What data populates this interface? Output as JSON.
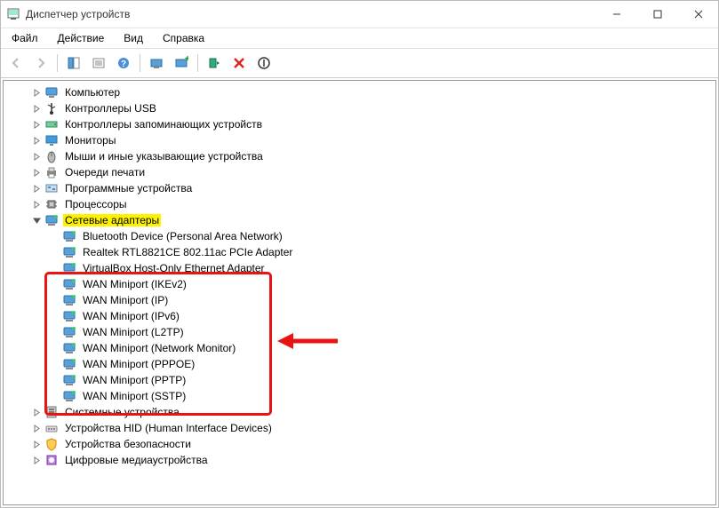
{
  "window": {
    "title": "Диспетчер устройств"
  },
  "menus": {
    "file": "Файл",
    "action": "Действие",
    "view": "Вид",
    "help": "Справка"
  },
  "tree": {
    "top_items": [
      "Компьютер",
      "Контроллеры USB",
      "Контроллеры запоминающих устройств",
      "Мониторы",
      "Мыши и иные указывающие устройства",
      "Очереди печати",
      "Программные устройства",
      "Процессоры"
    ],
    "network_category": "Сетевые адаптеры",
    "network_children_top": [
      "Bluetooth Device (Personal Area Network)",
      "Realtek RTL8821CE 802.11ac PCIe Adapter",
      "VirtualBox Host-Only Ethernet Adapter"
    ],
    "network_children_wan": [
      "WAN Miniport (IKEv2)",
      "WAN Miniport (IP)",
      "WAN Miniport (IPv6)",
      "WAN Miniport (L2TP)",
      "WAN Miniport (Network Monitor)",
      "WAN Miniport (PPPOE)",
      "WAN Miniport (PPTP)",
      "WAN Miniport (SSTP)"
    ],
    "bottom_items": [
      "Системные устройства",
      "Устройства HID (Human Interface Devices)",
      "Устройства безопасности",
      "Цифровые медиаустройства"
    ]
  }
}
